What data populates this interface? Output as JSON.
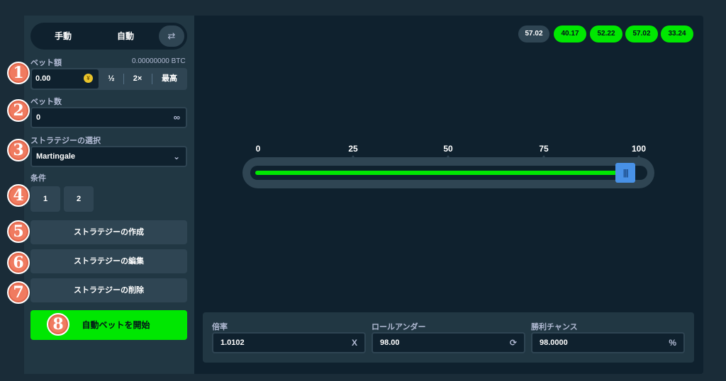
{
  "mode": {
    "manual": "手動",
    "auto": "自動",
    "swap_icon": "swap-icon"
  },
  "bet_amount": {
    "label": "ベット額",
    "balance": "0.00000000 BTC",
    "value": "0.00",
    "coin_icon": "¥",
    "half": "½",
    "double": "2×",
    "max": "最高"
  },
  "bet_count": {
    "label": "ベット数",
    "value": "0",
    "infinity_icon": "∞"
  },
  "strategy": {
    "label": "ストラテジーの選択",
    "value": "Martingale"
  },
  "conditions": {
    "label": "条件",
    "items": [
      "1",
      "2"
    ]
  },
  "actions": {
    "create": "ストラテジーの作成",
    "edit": "ストラテジーの編集",
    "delete": "ストラテジーの削除",
    "start": "自動ベットを開始"
  },
  "badges": [
    "1",
    "2",
    "3",
    "4",
    "5",
    "6",
    "7",
    "8"
  ],
  "history": [
    {
      "value": "57.02",
      "win": false
    },
    {
      "value": "40.17",
      "win": true
    },
    {
      "value": "52.22",
      "win": true
    },
    {
      "value": "57.02",
      "win": true
    },
    {
      "value": "33.24",
      "win": true
    }
  ],
  "slider": {
    "ticks": [
      "0",
      "25",
      "50",
      "75",
      "100"
    ],
    "value_fraction": 0.98,
    "thumb_glyph": "|||"
  },
  "stats": {
    "multiplier": {
      "label": "倍率",
      "value": "1.0102",
      "suffix": "X"
    },
    "roll_under": {
      "label": "ロールアンダー",
      "value": "98.00",
      "suffix": "⟳"
    },
    "win_chance": {
      "label": "勝利チャンス",
      "value": "98.0000",
      "suffix": "%"
    }
  },
  "colors": {
    "accent_green": "#00e701",
    "badge": "#f07b60",
    "thumb": "#4891e6",
    "panel": "#213743",
    "background": "#0f212e"
  }
}
